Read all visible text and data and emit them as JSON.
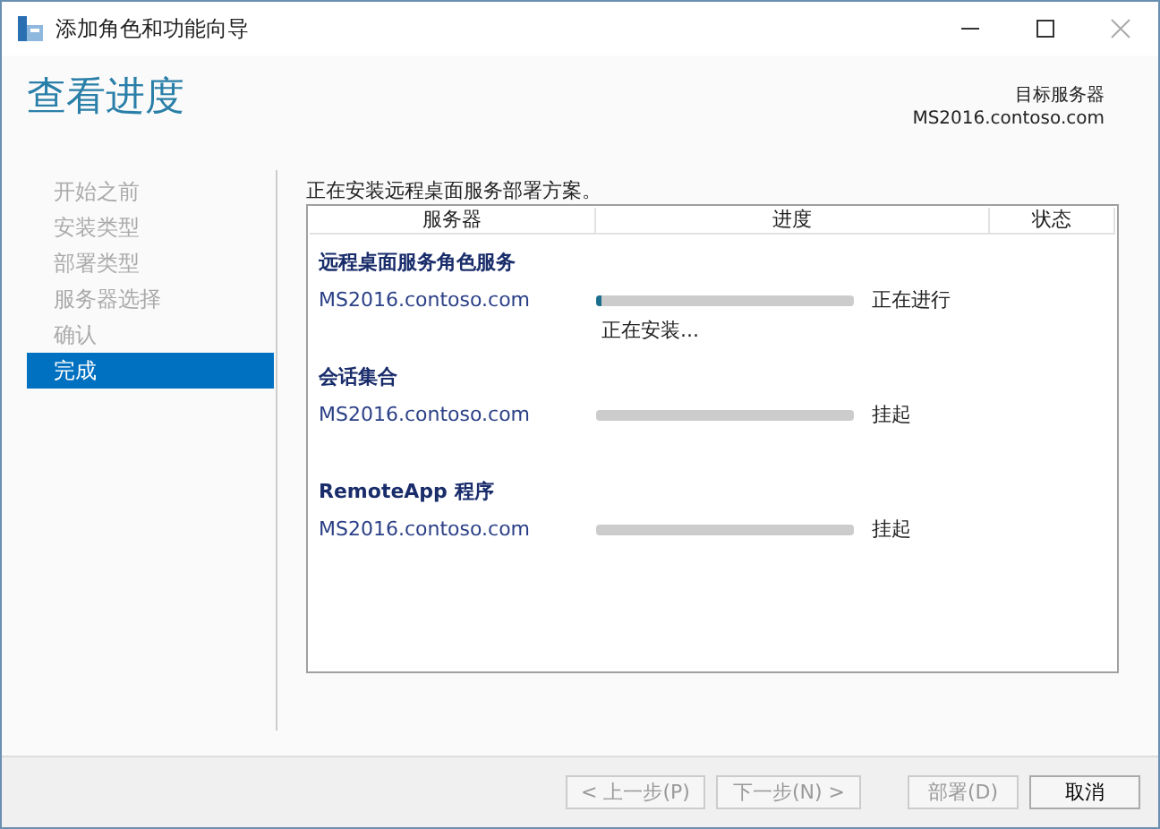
{
  "window": {
    "title": "添加角色和功能向导"
  },
  "header": {
    "title": "查看进度",
    "target_label": "目标服务器",
    "target_server": "MS2016.contoso.com"
  },
  "steps": [
    {
      "label": "开始之前",
      "selected": false
    },
    {
      "label": "安装类型",
      "selected": false
    },
    {
      "label": "部署类型",
      "selected": false
    },
    {
      "label": "服务器选择",
      "selected": false
    },
    {
      "label": "确认",
      "selected": false
    },
    {
      "label": "完成",
      "selected": true
    }
  ],
  "intro": "正在安装远程桌面服务部署方案。",
  "table": {
    "columns": [
      "服务器",
      "进度",
      "状态"
    ],
    "groups": [
      {
        "name": "远程桌面服务角色服务",
        "rows": [
          {
            "server": "MS2016.contoso.com",
            "level": 0.02,
            "status": "正在进行",
            "detail": "正在安装..."
          }
        ]
      },
      {
        "name": "会话集合",
        "rows": [
          {
            "server": "MS2016.contoso.com",
            "level": 0,
            "status": "挂起"
          }
        ]
      },
      {
        "name": "RemoteApp 程序",
        "rows": [
          {
            "server": "MS2016.contoso.com",
            "level": 0,
            "status": "挂起"
          }
        ]
      }
    ]
  },
  "buttons": [
    {
      "label": "< 上一步(P)",
      "disabled": true
    },
    {
      "label": "下一步(N) >",
      "disabled": true
    },
    {
      "label": "部署(D)",
      "disabled": true
    },
    {
      "label": "取消",
      "disabled": false
    }
  ]
}
